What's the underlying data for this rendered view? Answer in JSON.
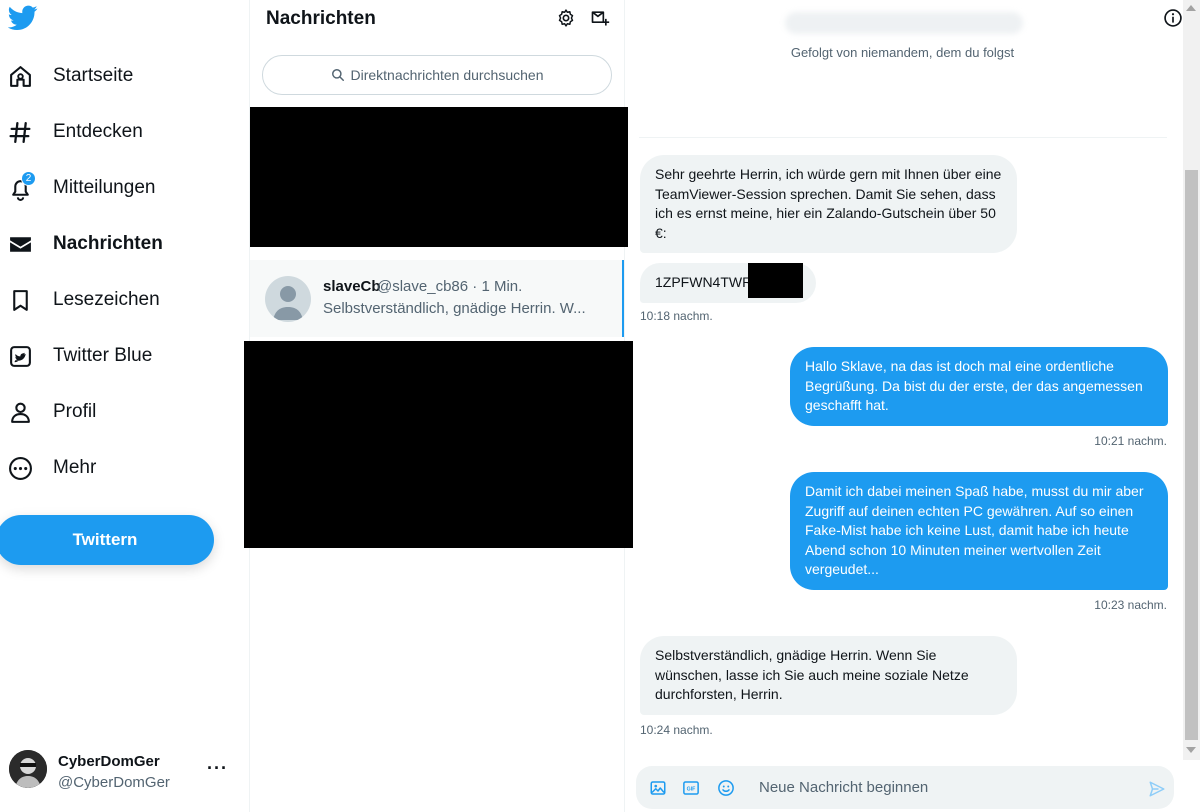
{
  "nav": {
    "items": [
      {
        "label": "Startseite",
        "icon": "home-icon"
      },
      {
        "label": "Entdecken",
        "icon": "hashtag-icon"
      },
      {
        "label": "Mitteilungen",
        "icon": "bell-icon",
        "badge": "2"
      },
      {
        "label": "Nachrichten",
        "icon": "envelope-icon",
        "active": true
      },
      {
        "label": "Lesezeichen",
        "icon": "bookmark-icon"
      },
      {
        "label": "Twitter Blue",
        "icon": "twitter-blue-icon"
      },
      {
        "label": "Profil",
        "icon": "person-icon"
      },
      {
        "label": "Mehr",
        "icon": "more-circle-icon"
      }
    ],
    "tweet_button": "Twittern",
    "account": {
      "name": "CyberDomGer",
      "handle": "@CyberDomGer",
      "more": "···"
    }
  },
  "messages_list": {
    "title": "Nachrichten",
    "search_placeholder": "Direktnachrichten durchsuchen",
    "conversation": {
      "name": "slaveCb",
      "handle": "@slave_cb86 · 1 Min.",
      "preview": "Selbstverständlich, gnädige Herrin. W..."
    }
  },
  "chat": {
    "followed_by": "Gefolgt von niemandem, dem du folgst",
    "messages": [
      {
        "text": "Sehr geehrte Herrin, ich würde gern mit Ihnen über eine TeamViewer-Session sprechen. Damit Sie sehen, dass ich es ernst meine, hier ein Zalando-Gutschein über 50 €:"
      },
      {
        "text": "1ZPFWN4TWR",
        "time": "10:18 nachm."
      },
      {
        "text": "Hallo Sklave, na das ist doch mal eine ordentliche Begrüßung. Da bist du der erste, der das angemessen geschafft hat.",
        "time": "10:21 nachm."
      },
      {
        "text": "Damit ich dabei meinen Spaß habe, musst du mir aber Zugriff auf deinen echten PC gewähren. Auf so einen Fake-Mist habe ich keine Lust, damit habe ich heute Abend schon 10 Minuten meiner wertvollen Zeit vergeudet...",
        "time": "10:23 nachm."
      },
      {
        "text": "Selbstverständlich, gnädige Herrin. Wenn Sie wünschen, lasse ich Sie auch meine soziale Netze durchforsten, Herrin.",
        "time": "10:24 nachm."
      }
    ],
    "composer_placeholder": "Neue Nachricht beginnen",
    "gif_label": "GIF"
  },
  "colors": {
    "accent": "#1d9bf0",
    "bubble_in": "#eff3f4",
    "text": "#0f1419",
    "muted": "#536471"
  }
}
